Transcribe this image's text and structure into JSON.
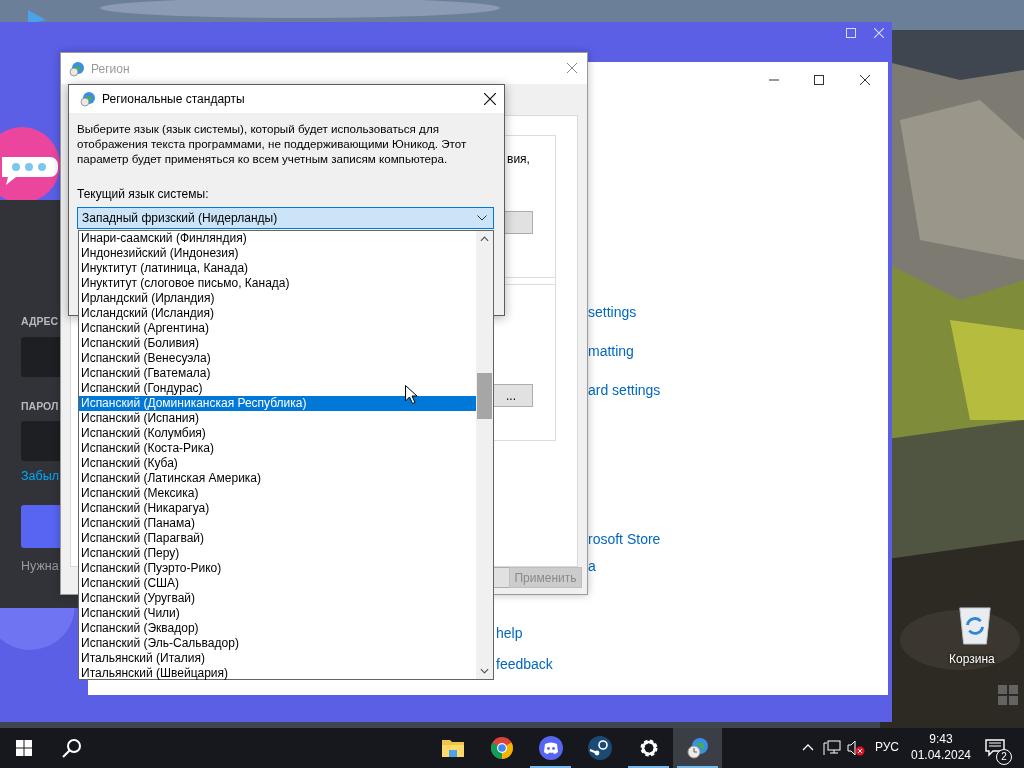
{
  "login_panel": {
    "email_label": "АДРЕС",
    "password_label": "ПАРОЛ",
    "forgot_link": "Забыл",
    "register_text": "Нужна"
  },
  "settings_window": {
    "links_top": [
      "settings",
      "matting",
      "ard settings"
    ],
    "links_store": [
      "rosoft Store",
      "a"
    ],
    "links_help": [
      "help",
      "feedback"
    ]
  },
  "region_window": {
    "title": "Регион",
    "text_fragment": "вия,",
    "more_button": "...",
    "apply_button": {
      "label": "Применить",
      "disabled": true
    }
  },
  "dialog": {
    "title": "Региональные стандарты",
    "description": "Выберите язык (язык системы), который будет использоваться для отображения текста программами, не поддерживающими Юникод. Этот параметр будет применяться ко всем учетным записям компьютера.",
    "label": "Текущий язык системы:",
    "combo_value": "Западный фризский (Нидерланды)",
    "options": [
      {
        "label": "Инари-саамский (Финляндия)",
        "selected": false
      },
      {
        "label": "Индонезийский (Индонезия)",
        "selected": false
      },
      {
        "label": "Инуктитут (латиница, Канада)",
        "selected": false
      },
      {
        "label": "Инуктитут (слоговое письмо, Канада)",
        "selected": false
      },
      {
        "label": "Ирландский (Ирландия)",
        "selected": false
      },
      {
        "label": "Исландский (Исландия)",
        "selected": false
      },
      {
        "label": "Испанский (Аргентина)",
        "selected": false
      },
      {
        "label": "Испанский (Боливия)",
        "selected": false
      },
      {
        "label": "Испанский (Венесуэла)",
        "selected": false
      },
      {
        "label": "Испанский (Гватемала)",
        "selected": false
      },
      {
        "label": "Испанский (Гондурас)",
        "selected": false
      },
      {
        "label": "Испанский (Доминиканская Республика)",
        "selected": true
      },
      {
        "label": "Испанский (Испания)",
        "selected": false
      },
      {
        "label": "Испанский (Колумбия)",
        "selected": false
      },
      {
        "label": "Испанский (Коста-Рика)",
        "selected": false
      },
      {
        "label": "Испанский (Куба)",
        "selected": false
      },
      {
        "label": "Испанский (Латинская Америка)",
        "selected": false
      },
      {
        "label": "Испанский (Мексика)",
        "selected": false
      },
      {
        "label": "Испанский (Никарагуа)",
        "selected": false
      },
      {
        "label": "Испанский (Панама)",
        "selected": false
      },
      {
        "label": "Испанский (Парагвай)",
        "selected": false
      },
      {
        "label": "Испанский (Перу)",
        "selected": false
      },
      {
        "label": "Испанский (Пуэрто-Рико)",
        "selected": false
      },
      {
        "label": "Испанский (США)",
        "selected": false
      },
      {
        "label": "Испанский (Уругвай)",
        "selected": false
      },
      {
        "label": "Испанский (Чили)",
        "selected": false
      },
      {
        "label": "Испанский (Эквадор)",
        "selected": false
      },
      {
        "label": "Испанский (Эль-Сальвадор)",
        "selected": false
      },
      {
        "label": "Итальянский (Италия)",
        "selected": false
      },
      {
        "label": "Итальянский (Швейцария)",
        "selected": false
      }
    ]
  },
  "desktop": {
    "recycle_bin": "Корзина"
  },
  "taskbar": {
    "apps": [
      {
        "kind": "folder",
        "running": false,
        "active": false
      },
      {
        "kind": "chrome",
        "running": false,
        "active": false
      },
      {
        "kind": "discord",
        "running": true,
        "active": false
      },
      {
        "kind": "steam",
        "running": false,
        "active": false
      },
      {
        "kind": "gear",
        "running": true,
        "active": false
      },
      {
        "kind": "region",
        "running": true,
        "active": true
      }
    ],
    "language": "РУС",
    "time": "9:43",
    "date": "01.04.2024",
    "notifications": "2"
  }
}
